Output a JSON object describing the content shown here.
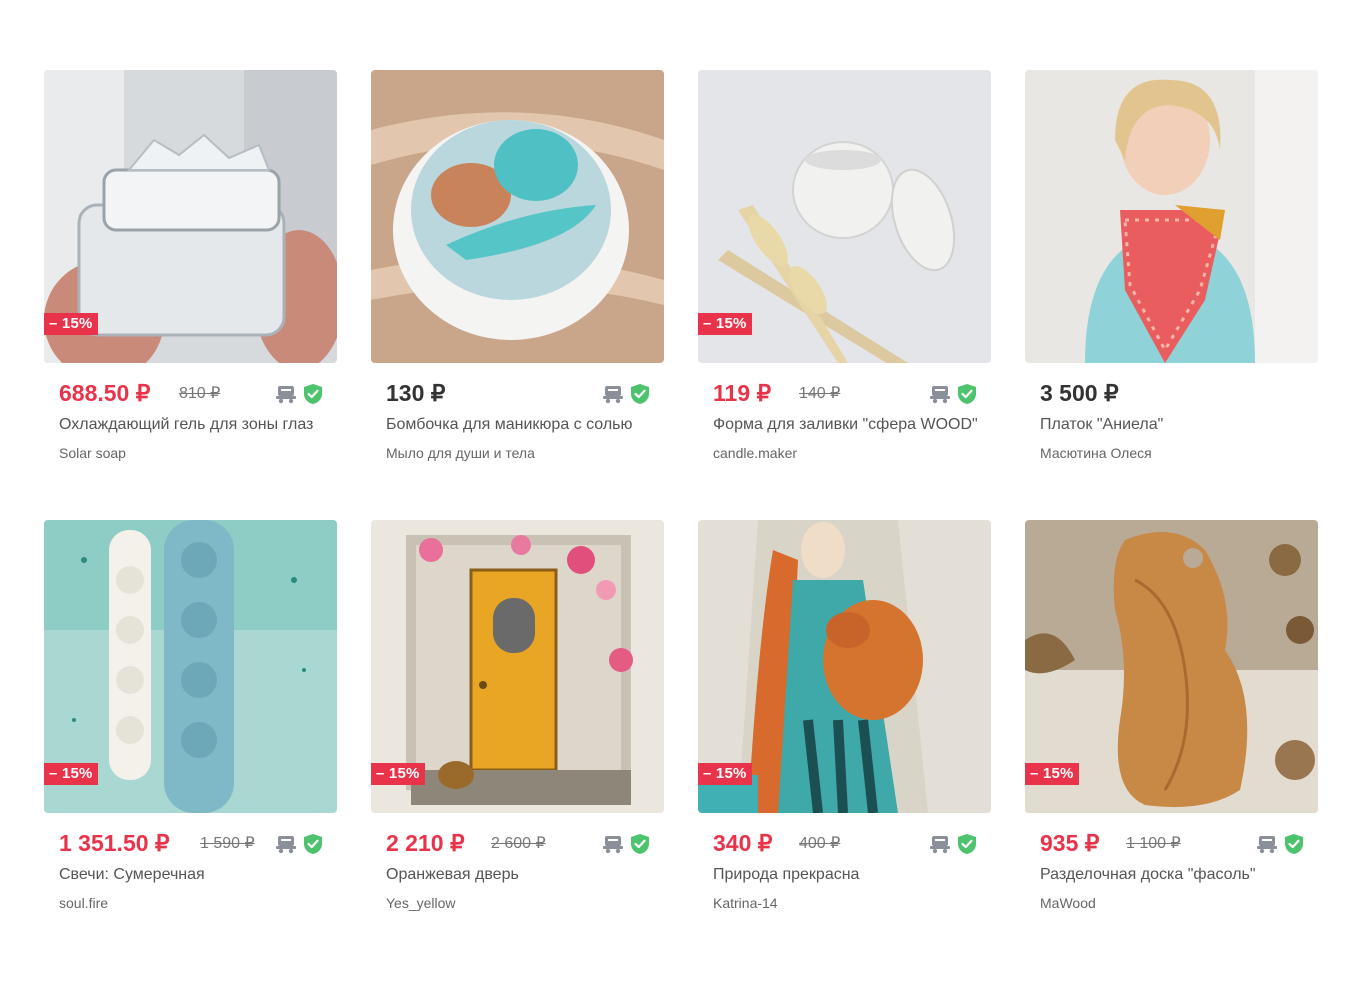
{
  "products": [
    {
      "title": "Охлаждающий гель для зоны глаз",
      "shop": "Solar soap",
      "price": "688.50 ₽",
      "old_price": "810 ₽",
      "discount": "– 15%"
    },
    {
      "title": "Бомбочка для маникюра с солью",
      "shop": "Мыло для души и тела",
      "price": "130 ₽",
      "old_price": "",
      "discount": ""
    },
    {
      "title": "Форма для заливки \"сфера WOOD\"",
      "shop": "candle.maker",
      "price": "119 ₽",
      "old_price": "140 ₽",
      "discount": "– 15%"
    },
    {
      "title": "Платок \"Аниела\"",
      "shop": "Масютина Олеся",
      "price": "3 500 ₽",
      "old_price": "",
      "discount": ""
    },
    {
      "title": "Свечи: Сумеречная",
      "shop": "soul.fire",
      "price": "1 351.50 ₽",
      "old_price": "1 590 ₽",
      "discount": "– 15%"
    },
    {
      "title": "Оранжевая дверь",
      "shop": "Yes_yellow",
      "price": "2 210 ₽",
      "old_price": "2 600 ₽",
      "discount": "– 15%"
    },
    {
      "title": "Природа прекрасна",
      "shop": "Katrina-14",
      "price": "340 ₽",
      "old_price": "400 ₽",
      "discount": "– 15%"
    },
    {
      "title": "Разделочная доска \"фасоль\"",
      "shop": "MaWood",
      "price": "935 ₽",
      "old_price": "1 100 ₽",
      "discount": "– 15%"
    }
  ],
  "icons": {
    "delivery": "delivery-truck-icon",
    "verified": "verified-shield-icon"
  },
  "colors": {
    "sale": "#e8334a",
    "verified": "#4cc36c",
    "delivery": "#8a8f99",
    "text": "#333333"
  }
}
